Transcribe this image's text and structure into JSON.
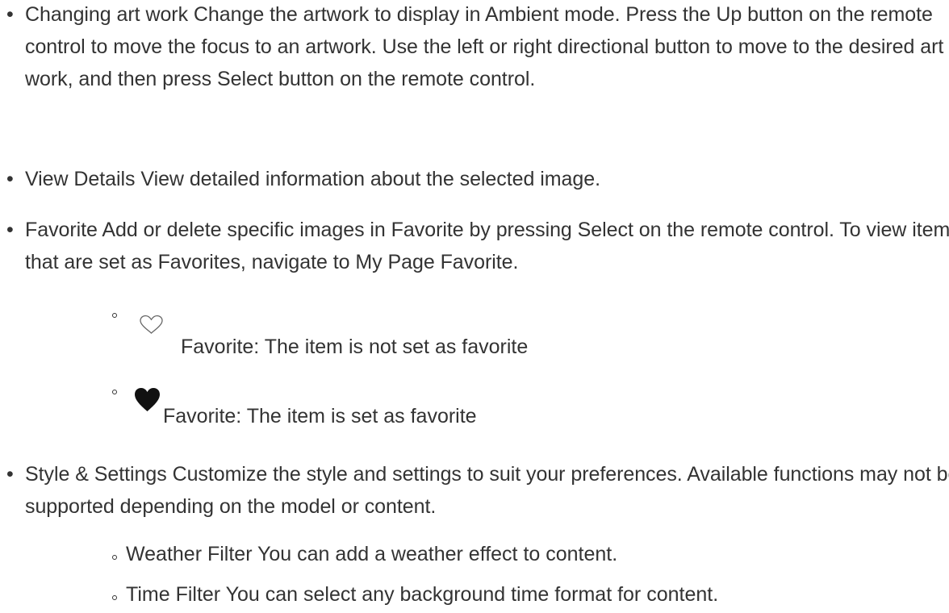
{
  "items": [
    {
      "text": "Changing art work Change the artwork to display in Ambient mode. Press the Up button on the remote control to move the focus to an artwork. Use the left or right directional button to move to the desired art work, and then press Select button on the remote control."
    },
    {
      "text": "View Details View detailed information about the selected image."
    },
    {
      "text": "Favorite Add or delete specific images in Favorite by pressing Select on the remote control. To view items that are set as Favorites, navigate to My Page Favorite.",
      "icon_rows": [
        {
          "icon": "heart-outline-icon",
          "text": "Favorite: The item is not set as favorite"
        },
        {
          "icon": "heart-filled-icon",
          "text": "Favorite: The item is set as favorite"
        }
      ]
    },
    {
      "text": "Style & Settings Customize the style and settings to suit your preferences. Available functions may not be supported depending on the model or content.",
      "sub_items": [
        {
          "text": "Weather Filter You can add a weather effect to content."
        },
        {
          "text": "Time Filter You can select any background time format for content."
        }
      ]
    }
  ]
}
